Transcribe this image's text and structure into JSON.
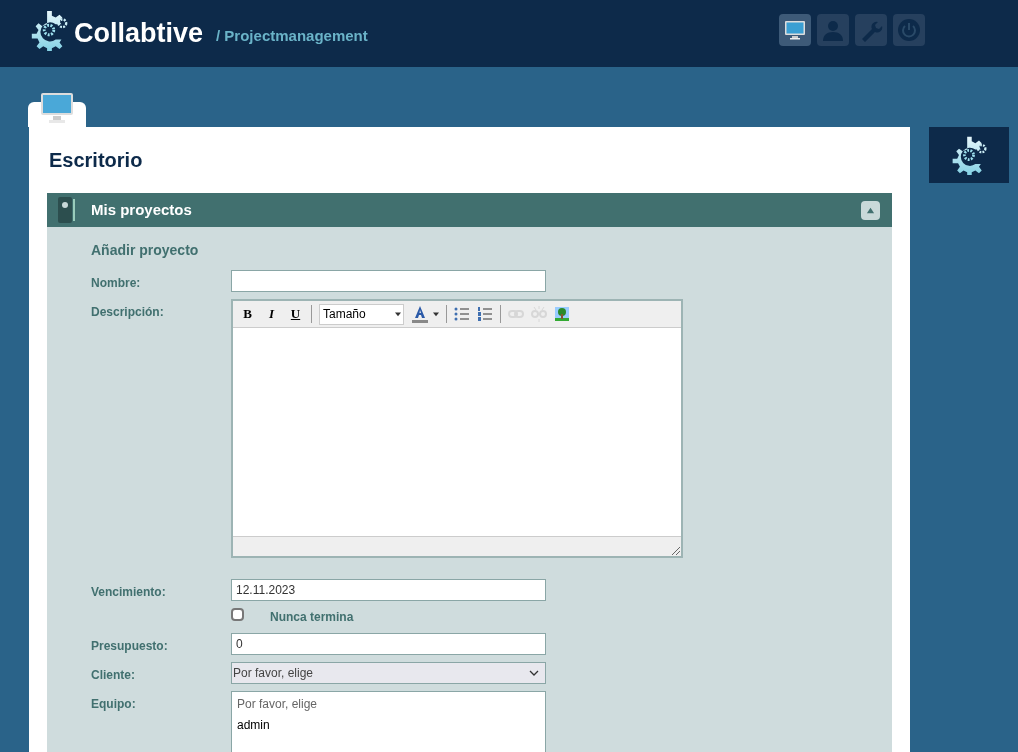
{
  "header": {
    "title": "Collabtive",
    "subtitle": "/ Projectmanagement"
  },
  "nav": [
    {
      "kind": "monitor",
      "selected": true
    },
    {
      "kind": "user",
      "selected": false
    },
    {
      "kind": "wrench",
      "selected": false
    },
    {
      "kind": "power",
      "selected": false
    }
  ],
  "page_title": "Escritorio",
  "section": {
    "title": "Mis proyectos",
    "expanded": true
  },
  "form_heading": "Añadir proyecto",
  "toolbar": [
    {
      "kind": "bold",
      "label": "B"
    },
    {
      "kind": "italic",
      "label": "I"
    },
    {
      "kind": "underline",
      "label": "U"
    },
    {
      "kind": "sep"
    },
    {
      "kind": "size",
      "label": "Tamaño"
    },
    {
      "kind": "color"
    },
    {
      "kind": "sep"
    },
    {
      "kind": "bullets",
      "disabled": false
    },
    {
      "kind": "numbers",
      "disabled": false
    },
    {
      "kind": "sep"
    },
    {
      "kind": "link",
      "disabled": true
    },
    {
      "kind": "unlink",
      "disabled": true
    },
    {
      "kind": "image",
      "disabled": false
    }
  ],
  "fields": [
    {
      "kind": "text",
      "label": "Nombre:"
    },
    {
      "kind": "editor",
      "label": "Descripción:"
    },
    {
      "kind": "text",
      "label": "Vencimiento:",
      "value": "12.11.2023"
    },
    {
      "kind": "checkbox",
      "label": "Nunca termina",
      "checked": false
    },
    {
      "kind": "text",
      "label": "Presupuesto:",
      "value": "0"
    },
    {
      "kind": "select",
      "label": "Cliente:",
      "value": "Por favor, elige"
    },
    {
      "kind": "listbox",
      "label": "Equipo:",
      "options": [
        {
          "text": "Por favor, elige",
          "disabled": true
        },
        {
          "text": "admin",
          "disabled": false
        }
      ]
    }
  ]
}
